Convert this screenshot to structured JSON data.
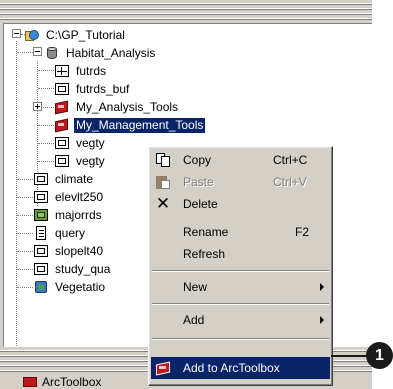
{
  "tree": {
    "root": {
      "label": "C:\\GP_Tutorial",
      "icon": "folder-globe-icon"
    },
    "geodatabase": {
      "label": "Habitat_Analysis",
      "icon": "geodatabase-icon"
    },
    "children": [
      {
        "label": "futrds",
        "icon": "line-feature-class-icon"
      },
      {
        "label": "futrds_buf",
        "icon": "polygon-feature-class-icon"
      },
      {
        "label": "My_Analysis_Tools",
        "icon": "toolbox-icon"
      },
      {
        "label": "My_Management_Tools",
        "icon": "toolbox-icon",
        "selected": true
      },
      {
        "label": "vegty",
        "icon": "polygon-feature-class-icon"
      },
      {
        "label": "vegty",
        "icon": "polygon-feature-class-icon"
      }
    ],
    "folder_items": [
      {
        "label": "climate",
        "icon": "raster-icon"
      },
      {
        "label": "elevlt250",
        "icon": "raster-icon"
      },
      {
        "label": "majorrds",
        "icon": "line-feature-class-icon"
      },
      {
        "label": "query",
        "icon": "table-icon"
      },
      {
        "label": "slopelt40",
        "icon": "raster-icon"
      },
      {
        "label": "study_qua",
        "icon": "raster-icon"
      },
      {
        "label": "Vegetatio",
        "icon": "layer-icon"
      }
    ]
  },
  "context_menu": {
    "copy": {
      "label": "Copy",
      "shortcut": "Ctrl+C"
    },
    "paste": {
      "label": "Paste",
      "shortcut": "Ctrl+V",
      "disabled": true
    },
    "delete": {
      "label": "Delete"
    },
    "rename": {
      "label": "Rename",
      "shortcut": "F2"
    },
    "refresh": {
      "label": "Refresh"
    },
    "new": {
      "label": "New"
    },
    "add": {
      "label": "Add"
    },
    "add_to_arctoolbox": {
      "label": "Add to ArcToolbox"
    }
  },
  "bottom_pane": {
    "label": "ArcToolbox"
  },
  "callout": {
    "number": "1"
  },
  "colors": {
    "selection": "#0a246a",
    "window": "#d4d0c8",
    "toolbox_red": "#c0181c"
  }
}
